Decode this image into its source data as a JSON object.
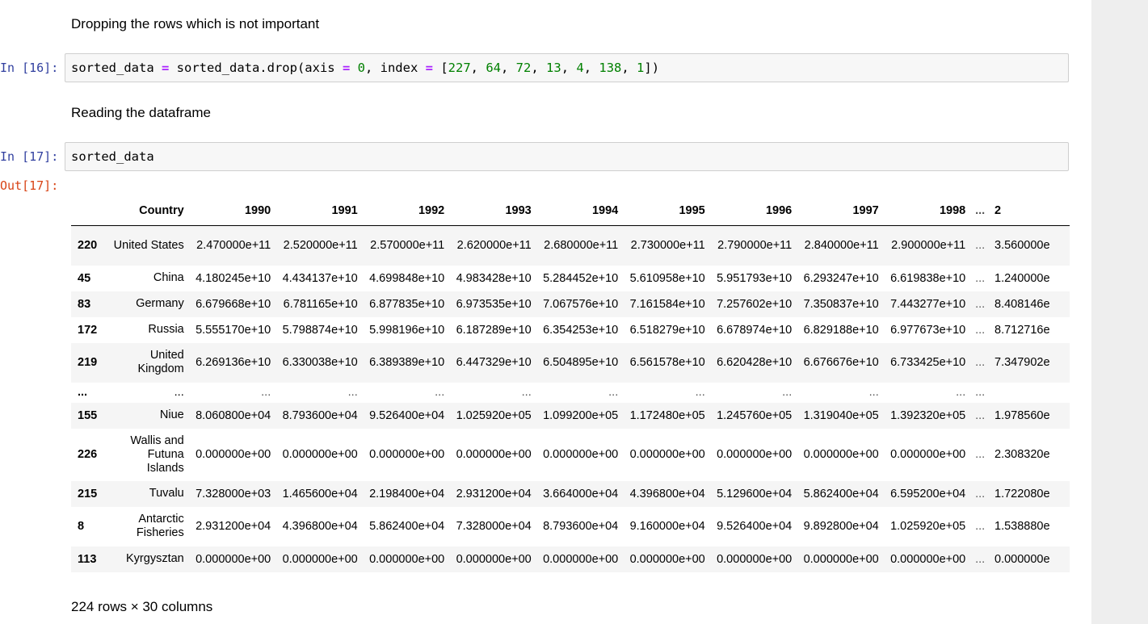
{
  "markdown": {
    "drop_note": "Dropping the rows which is not important",
    "read_note": "Reading the dataframe"
  },
  "cells": {
    "in16_prompt": "In [16]:",
    "in17_prompt": "In [17]:",
    "out17_prompt": "Out[17]:",
    "in17_code": "sorted_data"
  },
  "code16": {
    "var": "sorted_data ",
    "eq1": "=",
    "call": " sorted_data.drop(axis ",
    "eq2": "=",
    "zero": " 0",
    "mid": ", index ",
    "eq3": "=",
    "open": " [",
    "n1": "227",
    "n2": "64",
    "n3": "72",
    "n4": "13",
    "n5": "4",
    "n6": "138",
    "n7": "1",
    "sep": ", ",
    "close": "])"
  },
  "table": {
    "columns": [
      "",
      "Country",
      "1990",
      "1991",
      "1992",
      "1993",
      "1994",
      "1995",
      "1996",
      "1997",
      "1998",
      "...",
      "2"
    ],
    "rows": [
      {
        "index": "220",
        "country": "United States",
        "values": [
          "2.470000e+11",
          "2.520000e+11",
          "2.570000e+11",
          "2.620000e+11",
          "2.680000e+11",
          "2.730000e+11",
          "2.790000e+11",
          "2.840000e+11",
          "2.900000e+11"
        ],
        "ell": "...",
        "last": "3.560000e"
      },
      {
        "index": "45",
        "country": "China",
        "values": [
          "4.180245e+10",
          "4.434137e+10",
          "4.699848e+10",
          "4.983428e+10",
          "5.284452e+10",
          "5.610958e+10",
          "5.951793e+10",
          "6.293247e+10",
          "6.619838e+10"
        ],
        "ell": "...",
        "last": "1.240000e"
      },
      {
        "index": "83",
        "country": "Germany",
        "values": [
          "6.679668e+10",
          "6.781165e+10",
          "6.877835e+10",
          "6.973535e+10",
          "7.067576e+10",
          "7.161584e+10",
          "7.257602e+10",
          "7.350837e+10",
          "7.443277e+10"
        ],
        "ell": "...",
        "last": "8.408146e"
      },
      {
        "index": "172",
        "country": "Russia",
        "values": [
          "5.555170e+10",
          "5.798874e+10",
          "5.998196e+10",
          "6.187289e+10",
          "6.354253e+10",
          "6.518279e+10",
          "6.678974e+10",
          "6.829188e+10",
          "6.977673e+10"
        ],
        "ell": "...",
        "last": "8.712716e"
      },
      {
        "index": "219",
        "country": "United Kingdom",
        "values": [
          "6.269136e+10",
          "6.330038e+10",
          "6.389389e+10",
          "6.447329e+10",
          "6.504895e+10",
          "6.561578e+10",
          "6.620428e+10",
          "6.676676e+10",
          "6.733425e+10"
        ],
        "ell": "...",
        "last": "7.347902e"
      },
      {
        "index": "...",
        "country": "...",
        "values": [
          "...",
          "...",
          "...",
          "...",
          "...",
          "...",
          "...",
          "...",
          "..."
        ],
        "ell": "...",
        "last": ""
      },
      {
        "index": "155",
        "country": "Niue",
        "values": [
          "8.060800e+04",
          "8.793600e+04",
          "9.526400e+04",
          "1.025920e+05",
          "1.099200e+05",
          "1.172480e+05",
          "1.245760e+05",
          "1.319040e+05",
          "1.392320e+05"
        ],
        "ell": "...",
        "last": "1.978560e"
      },
      {
        "index": "226",
        "country": "Wallis and Futuna Islands",
        "values": [
          "0.000000e+00",
          "0.000000e+00",
          "0.000000e+00",
          "0.000000e+00",
          "0.000000e+00",
          "0.000000e+00",
          "0.000000e+00",
          "0.000000e+00",
          "0.000000e+00"
        ],
        "ell": "...",
        "last": "2.308320e"
      },
      {
        "index": "215",
        "country": "Tuvalu",
        "values": [
          "7.328000e+03",
          "1.465600e+04",
          "2.198400e+04",
          "2.931200e+04",
          "3.664000e+04",
          "4.396800e+04",
          "5.129600e+04",
          "5.862400e+04",
          "6.595200e+04"
        ],
        "ell": "...",
        "last": "1.722080e"
      },
      {
        "index": "8",
        "country": "Antarctic Fisheries",
        "values": [
          "2.931200e+04",
          "4.396800e+04",
          "5.862400e+04",
          "7.328000e+04",
          "8.793600e+04",
          "9.160000e+04",
          "9.526400e+04",
          "9.892800e+04",
          "1.025920e+05"
        ],
        "ell": "...",
        "last": "1.538880e"
      },
      {
        "index": "113",
        "country": "Kyrgysztan",
        "values": [
          "0.000000e+00",
          "0.000000e+00",
          "0.000000e+00",
          "0.000000e+00",
          "0.000000e+00",
          "0.000000e+00",
          "0.000000e+00",
          "0.000000e+00",
          "0.000000e+00"
        ],
        "ell": "...",
        "last": "0.000000e"
      }
    ],
    "shape": "224 rows × 30 columns"
  }
}
